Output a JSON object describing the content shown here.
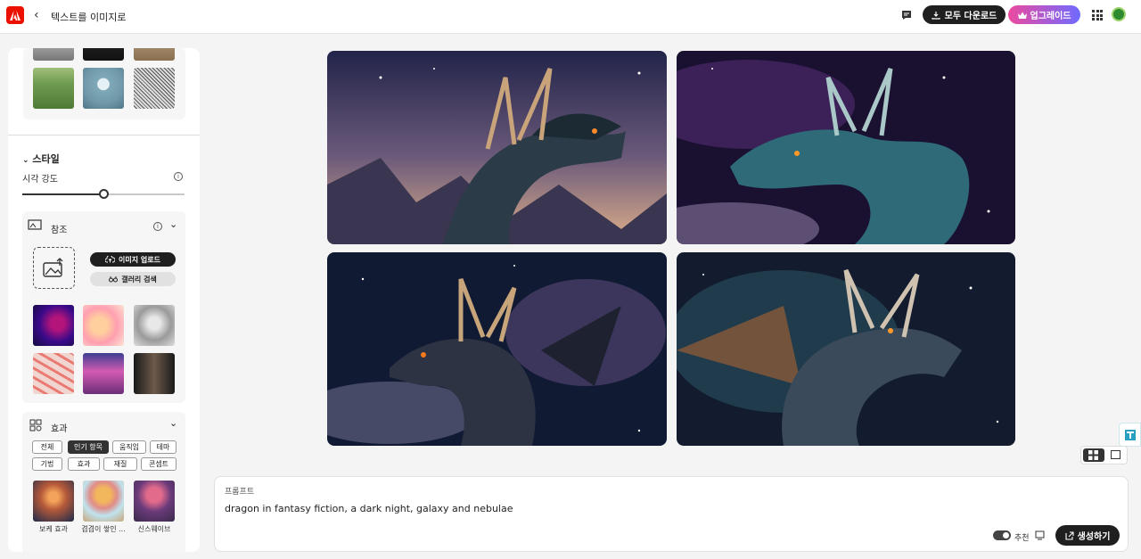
{
  "header": {
    "title": "텍스트를 이미지로",
    "download_all": "모두 다운로드",
    "upgrade": "업그레이드"
  },
  "sidebar": {
    "style_section": {
      "title": "스타일",
      "visual_intensity_label": "시각 강도",
      "visual_intensity_value": 0.5
    },
    "reference": {
      "title": "참조",
      "upload_image": "이미지 업로드",
      "gallery_search": "갤러리 검색"
    },
    "effects": {
      "title": "효과",
      "filters": [
        "전체",
        "인기 항목",
        "움직임",
        "테마",
        "기법",
        "효과",
        "재질",
        "콘셉트"
      ],
      "active_filter": "인기 항목",
      "items": [
        "보케 효과",
        "겹겹이 쌓인 ...",
        "신스웨이브"
      ]
    }
  },
  "prompt": {
    "label": "프롬프트",
    "text": "dragon in fantasy fiction, a dark night, galaxy and nebulae",
    "recommend_label": "추천",
    "generate": "생성하기"
  },
  "colors": {
    "adobe_red": "#eb1000",
    "dark": "#1f1f1f",
    "upgrade_gradient": [
      "#ec4a9f",
      "#6f6bff"
    ]
  }
}
